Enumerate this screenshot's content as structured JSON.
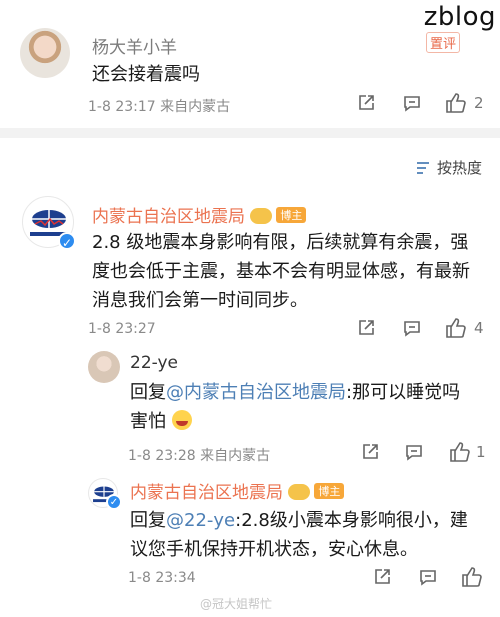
{
  "watermark": "zblog",
  "comment1": {
    "username": "杨大羊小羊",
    "tag": "置评",
    "text": "还会接着震吗",
    "meta": "1-8 23:17  来自内蒙古",
    "like_count": "2"
  },
  "sort": {
    "label": "按热度"
  },
  "comment2": {
    "username": "内蒙古自治区地震局",
    "badge": "博主",
    "text": "2.8 级地震本身影响有限，后续就算有余震，强度也会低于主震，基本不会有明显体感，有最新消息我们会第一时间同步。",
    "meta": "1-8 23:27",
    "like_count": "4"
  },
  "reply1": {
    "username": "22-ye",
    "prefix": "回复",
    "mention": "@内蒙古自治区地震局",
    "text": ":那可以睡觉吗 害怕",
    "meta": "1-8 23:28  来自内蒙古",
    "like_count": "1"
  },
  "reply2": {
    "username": "内蒙古自治区地震局",
    "badge": "博主",
    "prefix": "回复",
    "mention": "@22-ye",
    "text": ":2.8级小震本身影响很小，建议您手机保持开机状态，安心休息。",
    "meta": "1-8 23:34",
    "like_count": ""
  },
  "footer_watermark": "@冠大姐帮忙",
  "colors": {
    "mention": "#4d7fb5",
    "username_vip": "#eb7350",
    "divider": "#f2f2f2"
  },
  "icons": [
    "share-icon",
    "comment-icon",
    "like-icon",
    "sort-icon",
    "verified-icon"
  ]
}
